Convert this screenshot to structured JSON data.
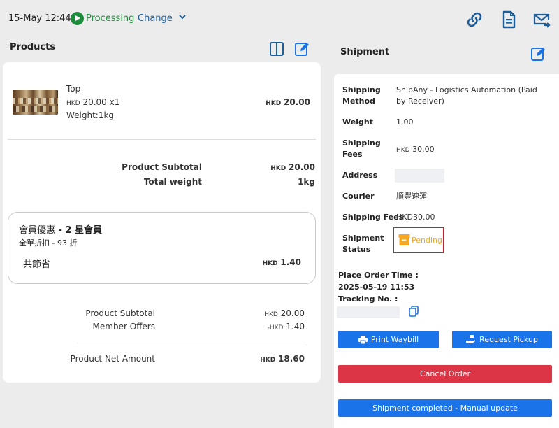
{
  "header": {
    "datetime": "15-May 12:44",
    "status": "Processing",
    "change_label": "Change"
  },
  "products": {
    "title": "Products",
    "item": {
      "name": "Top",
      "currency": "HKD",
      "unit_price": "20.00 x1",
      "weight": "Weight:1kg",
      "line_total": "20.00"
    },
    "subtotal_label": "Product Subtotal",
    "subtotal_value": "20.00",
    "total_weight_label": "Total weight",
    "total_weight_value": "1kg",
    "offer": {
      "title": "會員優惠",
      "title_suffix": " - 2 星會員",
      "sub": "全單折扣 - 93 折",
      "save_label": "共節省",
      "save_value": "1.40"
    },
    "summary": {
      "subtotal_label": "Product Subtotal",
      "subtotal_value": "20.00",
      "member_label": "Member Offers",
      "member_prefix": "-HKD",
      "member_value": "1.40",
      "net_label": "Product Net Amount",
      "net_value": "18.60"
    }
  },
  "shipment": {
    "title": "Shipment",
    "method_label": "Shipping Method",
    "method_value": "ShipAny - Logistics Automation (Paid by Receiver)",
    "weight_label": "Weight",
    "weight_value": "1.00",
    "fees_label": "Shipping Fees",
    "fees_value": "30.00",
    "address_label": "Address",
    "courier_label": "Courier",
    "courier_value": "順豐速運",
    "fees2_label": "Shipping Fees",
    "fees2_value": "HKD30.00",
    "status_label": "Shipment Status",
    "status_value": "Pending",
    "place_order_label": "Place Order Time :",
    "place_order_value": "2025-05-19 11:53",
    "tracking_label": "Tracking No. :",
    "print_label": "Print Waybill",
    "pickup_label": "Request Pickup",
    "cancel_label": "Cancel Order",
    "complete_label": "Shipment completed - Manual update"
  },
  "colors": {
    "primary": "#1a73e8",
    "danger": "#dc3545",
    "success": "#1e8e3e",
    "pending": "#f5a623"
  }
}
